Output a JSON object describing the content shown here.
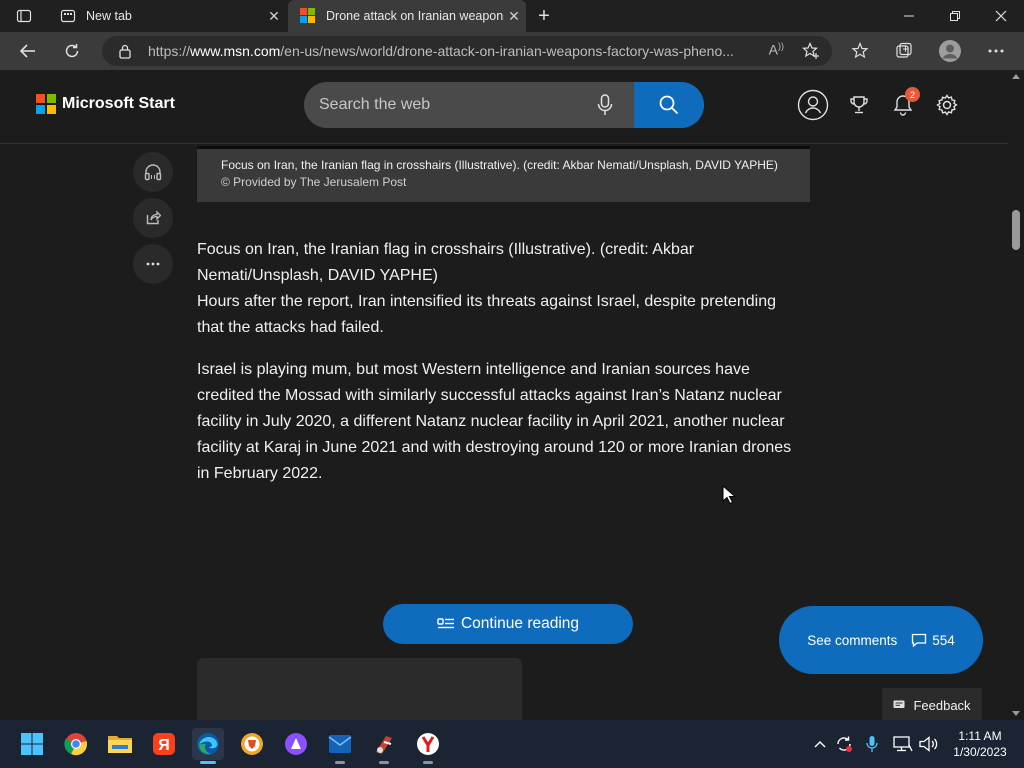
{
  "browser": {
    "tabs": [
      {
        "title": "New tab",
        "active": false
      },
      {
        "title": "Drone attack on Iranian weapons",
        "active": true
      }
    ],
    "url_prefix": "https://",
    "url_domain": "www.msn.com",
    "url_path": "/en-us/news/world/drone-attack-on-iranian-weapons-factory-was-pheno...",
    "read_aloud": "A",
    "window_controls": [
      "minimize",
      "restore",
      "close"
    ]
  },
  "site": {
    "brand": "Microsoft Start",
    "search_placeholder": "Search the web",
    "notifications_count": "2"
  },
  "article": {
    "caption": "Focus on Iran, the Iranian flag in crosshairs (Illustrative). (credit: Akbar Nemati/Unsplash, DAVID YAPHE)",
    "provider": "© Provided by The Jerusalem Post",
    "paragraphs": [
      "Focus on Iran, the Iranian flag in crosshairs (Illustrative). (credit: Akbar Nemati/Unsplash, DAVID YAPHE)",
      "Hours after the report, Iran intensified its threats against Israel, despite pretending that the attacks had failed.",
      "Israel is playing mum, but most Western intelligence and Iranian sources have credited the Mossad with similarly successful attacks against Iran’s Natanz nuclear facility in July 2020, a different Natanz nuclear facility in April 2021, another nuclear facility at Karaj in June 2021 and with destroying around 120 or more Iranian drones in February 2022."
    ],
    "continue_label": "Continue reading",
    "comments_label": "See comments",
    "comments_count": "554",
    "feedback_label": "Feedback"
  },
  "taskbar": {
    "time": "1:11 AM",
    "date": "1/30/2023",
    "apps": [
      "start",
      "chrome",
      "yandex-browser",
      "file-explorer",
      "edge",
      "brave",
      "alice",
      "mail",
      "ccleaner",
      "yandex"
    ]
  },
  "colors": {
    "accent": "#0f6cbd",
    "page_bg": "#1c1c1c",
    "badge": "#e8593a"
  }
}
